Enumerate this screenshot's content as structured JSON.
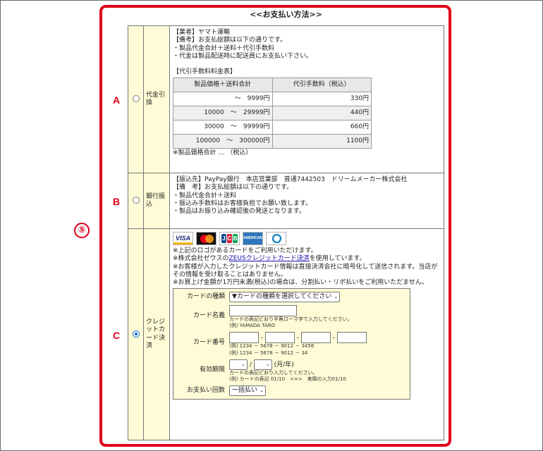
{
  "marker": {
    "number": "⑤",
    "letters": [
      "A",
      "B",
      "C"
    ]
  },
  "title": "<<お支払い方法>>",
  "options": {
    "cod": {
      "name": "代金引換",
      "selected": false,
      "lines": [
        "【業者】ヤマト運輸",
        "【備考】お支払総額は以下の通りです。",
        "・製品代金合計＋送料＋代引手数料",
        "・代金は製品配送時に配送員にお支払い下さい。"
      ],
      "fee_title": "【代引手数料料金表】",
      "fee_headers": [
        "製品価格＋送料合計",
        "代引手数料（税込）"
      ],
      "fee_rows": [
        {
          "range": "〜　9999円",
          "fee": "330円"
        },
        {
          "range": "10000　〜　29999円",
          "fee": "440円"
        },
        {
          "range": "30000　〜　99999円",
          "fee": "660円"
        },
        {
          "range": "100000　〜　300000円",
          "fee": "1100円"
        }
      ],
      "note": "※製品価格合計 … （税込）"
    },
    "bank": {
      "name": "銀行振込",
      "selected": false,
      "lines": [
        "【振込先】PayPay銀行　本店営業部　普通7442503　ドリームメーカー株式会社",
        "【備　考】お支払総額は以下の通りです。",
        "・製品代金合計＋送料",
        "・振込み手数料はお客様負担でお願い致します。",
        "・製品はお振り込み確認後の発送となります。"
      ]
    },
    "credit": {
      "name": "クレジットカード決済",
      "selected": true,
      "logos": [
        "visa-logo",
        "mastercard-logo",
        "jcb-logo",
        "amex-logo",
        "diners-club-logo"
      ],
      "logo_texts": {
        "visa": "VISA",
        "jcb": [
          "J",
          "C",
          "B"
        ],
        "amex": "AMERICAN EXPRESS"
      },
      "line1": "※上記のロゴがあるカードをご利用いただけます。",
      "line2_pre": "※株式会社ゼウスの",
      "line2_link": "ZEUSクレジットカード決済",
      "line2_post": "を使用しています。",
      "line3": "※お客様が入力したクレジットカード情報は直接決済会社に暗号化して送信されます。当店がその情報を受け取ることはありません。",
      "line4": "※お買上げ金額が1万円未満(税込)の場合は、分割払い・リボ払いをご利用いただません。",
      "form": {
        "card_type_label": "カードの種類",
        "card_type_value": "▼カードの種類を選択してください",
        "card_name_label": "カード名義",
        "card_name_hint1": "カードの表記どおり半角ローマ字で入力してください。",
        "card_name_hint2": "(例) YAMADA TARO",
        "card_number_label": "カード番号",
        "card_number_sep": "-",
        "card_number_hint1": "(例) 1234 － 5678 － 9012 － 3456",
        "card_number_hint2": "(例) 1234 － 5678 － 9012 － 34",
        "expiry_label": "有効期限",
        "expiry_sep": "/",
        "expiry_unit": "(月/年)",
        "expiry_hint1": "カードの表記どおり入力してください。",
        "expiry_hint2": "(例) カードの表記 01/10　==>　実際の入力01/10",
        "installment_label": "お支払い回数",
        "installment_value": "一括払い"
      }
    }
  },
  "colors": {
    "accent": "#e0001a",
    "highlight": "#fffbd6",
    "radio": "#0a61d1",
    "link": "#1a0dab"
  }
}
